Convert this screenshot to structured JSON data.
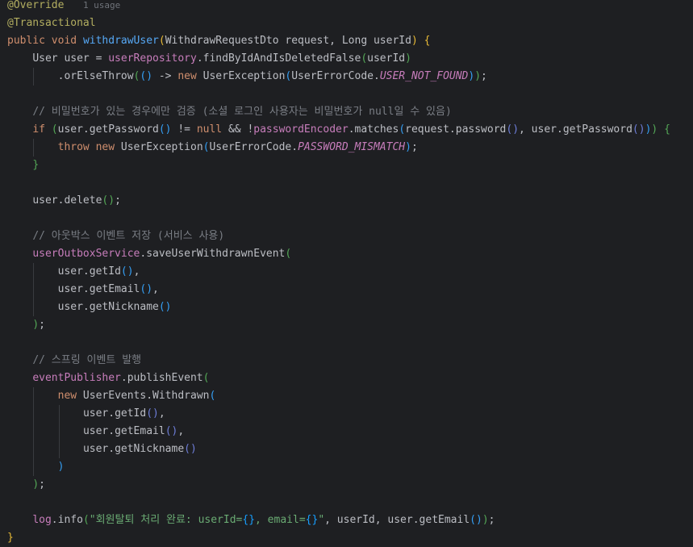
{
  "editor": {
    "language": "java",
    "theme": "dark",
    "colors": {
      "background": "#1e1f22",
      "default": "#bcbec4",
      "keyword": "#cf8e6d",
      "annotation": "#b3ae60",
      "method_declaration": "#56a8f5",
      "field": "#c77dbb",
      "comment": "#7a7e85",
      "string": "#6aab73",
      "inlay_hint": "#6f737a"
    },
    "lines": [
      {
        "indent": 0,
        "tokens": [
          {
            "t": "@Override",
            "c": "ann"
          },
          {
            "t": "   "
          },
          {
            "t": "1 usage",
            "c": "hint"
          }
        ]
      },
      {
        "indent": 0,
        "tokens": [
          {
            "t": "@Transactional",
            "c": "ann"
          }
        ]
      },
      {
        "indent": 0,
        "tokens": [
          {
            "t": "public",
            "c": "kw"
          },
          {
            "t": " "
          },
          {
            "t": "void",
            "c": "kw"
          },
          {
            "t": " "
          },
          {
            "t": "withdrawUser",
            "c": "fn"
          },
          {
            "t": "(",
            "c": "p1"
          },
          {
            "t": "WithdrawRequestDto request, Long userId"
          },
          {
            "t": ")",
            "c": "p1"
          },
          {
            "t": " "
          },
          {
            "t": "{",
            "c": "p1"
          }
        ]
      },
      {
        "indent": 1,
        "tokens": [
          {
            "t": "User user = "
          },
          {
            "t": "userRepository",
            "c": "field"
          },
          {
            "t": ".findByIdAndIsDeletedFalse"
          },
          {
            "t": "(",
            "c": "p2"
          },
          {
            "t": "userId"
          },
          {
            "t": ")",
            "c": "p2"
          }
        ]
      },
      {
        "indent": 2,
        "tokens": [
          {
            "t": ".orElseThrow"
          },
          {
            "t": "(",
            "c": "p2"
          },
          {
            "t": "()",
            "c": "p3"
          },
          {
            "t": " -> "
          },
          {
            "t": "new",
            "c": "kw"
          },
          {
            "t": " UserException"
          },
          {
            "t": "(",
            "c": "p3"
          },
          {
            "t": "UserErrorCode."
          },
          {
            "t": "USER_NOT_FOUND",
            "c": "static"
          },
          {
            "t": ")",
            "c": "p3"
          },
          {
            "t": ")",
            "c": "p2"
          },
          {
            "t": ";"
          }
        ]
      },
      {
        "indent": 0,
        "tokens": []
      },
      {
        "indent": 1,
        "tokens": [
          {
            "t": "// 비밀번호가 있는 경우에만 검증 (소셜 로그인 사용자는 비밀번호가 null일 수 있음)",
            "c": "cm"
          }
        ]
      },
      {
        "indent": 1,
        "tokens": [
          {
            "t": "if",
            "c": "kw"
          },
          {
            "t": " "
          },
          {
            "t": "(",
            "c": "p2"
          },
          {
            "t": "user.getPassword"
          },
          {
            "t": "()",
            "c": "p3"
          },
          {
            "t": " != "
          },
          {
            "t": "null",
            "c": "kw"
          },
          {
            "t": " && !"
          },
          {
            "t": "passwordEncoder",
            "c": "field"
          },
          {
            "t": ".matches"
          },
          {
            "t": "(",
            "c": "p3"
          },
          {
            "t": "request.password"
          },
          {
            "t": "()",
            "c": "p4"
          },
          {
            "t": ", user.getPassword"
          },
          {
            "t": "()",
            "c": "p4"
          },
          {
            "t": ")",
            "c": "p3"
          },
          {
            "t": ")",
            "c": "p2"
          },
          {
            "t": " "
          },
          {
            "t": "{",
            "c": "p2"
          }
        ]
      },
      {
        "indent": 2,
        "tokens": [
          {
            "t": "throw",
            "c": "kw"
          },
          {
            "t": " "
          },
          {
            "t": "new",
            "c": "kw"
          },
          {
            "t": " UserException"
          },
          {
            "t": "(",
            "c": "p3"
          },
          {
            "t": "UserErrorCode."
          },
          {
            "t": "PASSWORD_MISMATCH",
            "c": "static"
          },
          {
            "t": ")",
            "c": "p3"
          },
          {
            "t": ";"
          }
        ]
      },
      {
        "indent": 1,
        "tokens": [
          {
            "t": "}",
            "c": "p2"
          }
        ]
      },
      {
        "indent": 0,
        "tokens": []
      },
      {
        "indent": 1,
        "tokens": [
          {
            "t": "user.delete"
          },
          {
            "t": "()",
            "c": "p2"
          },
          {
            "t": ";"
          }
        ]
      },
      {
        "indent": 0,
        "tokens": []
      },
      {
        "indent": 1,
        "tokens": [
          {
            "t": "// 아웃박스 이벤트 저장 (서비스 사용)",
            "c": "cm"
          }
        ]
      },
      {
        "indent": 1,
        "tokens": [
          {
            "t": "userOutboxService",
            "c": "field"
          },
          {
            "t": ".saveUserWithdrawnEvent"
          },
          {
            "t": "(",
            "c": "p2"
          }
        ]
      },
      {
        "indent": 2,
        "tokens": [
          {
            "t": "user.getId"
          },
          {
            "t": "()",
            "c": "p3"
          },
          {
            "t": ","
          }
        ]
      },
      {
        "indent": 2,
        "tokens": [
          {
            "t": "user.getEmail"
          },
          {
            "t": "()",
            "c": "p3"
          },
          {
            "t": ","
          }
        ]
      },
      {
        "indent": 2,
        "tokens": [
          {
            "t": "user.getNickname"
          },
          {
            "t": "()",
            "c": "p3"
          }
        ]
      },
      {
        "indent": 1,
        "tokens": [
          {
            "t": ")",
            "c": "p2"
          },
          {
            "t": ";"
          }
        ]
      },
      {
        "indent": 0,
        "tokens": []
      },
      {
        "indent": 1,
        "tokens": [
          {
            "t": "// 스프링 이벤트 발행",
            "c": "cm"
          }
        ]
      },
      {
        "indent": 1,
        "tokens": [
          {
            "t": "eventPublisher",
            "c": "field"
          },
          {
            "t": ".publishEvent"
          },
          {
            "t": "(",
            "c": "p2"
          }
        ]
      },
      {
        "indent": 2,
        "tokens": [
          {
            "t": "new",
            "c": "kw"
          },
          {
            "t": " UserEvents.Withdrawn"
          },
          {
            "t": "(",
            "c": "p3"
          }
        ]
      },
      {
        "indent": 3,
        "tokens": [
          {
            "t": "user.getId"
          },
          {
            "t": "()",
            "c": "p4"
          },
          {
            "t": ","
          }
        ]
      },
      {
        "indent": 3,
        "tokens": [
          {
            "t": "user.getEmail"
          },
          {
            "t": "()",
            "c": "p4"
          },
          {
            "t": ","
          }
        ]
      },
      {
        "indent": 3,
        "tokens": [
          {
            "t": "user.getNickname"
          },
          {
            "t": "()",
            "c": "p4"
          }
        ]
      },
      {
        "indent": 2,
        "tokens": [
          {
            "t": ")",
            "c": "p3"
          }
        ]
      },
      {
        "indent": 1,
        "tokens": [
          {
            "t": ")",
            "c": "p2"
          },
          {
            "t": ";"
          }
        ]
      },
      {
        "indent": 0,
        "tokens": []
      },
      {
        "indent": 1,
        "tokens": [
          {
            "t": "log",
            "c": "field"
          },
          {
            "t": ".info"
          },
          {
            "t": "(",
            "c": "p2"
          },
          {
            "t": "\"회원탈퇴 처리 완료: userId=",
            "c": "str"
          },
          {
            "t": "{}",
            "c": "p5"
          },
          {
            "t": ", email=",
            "c": "str"
          },
          {
            "t": "{}",
            "c": "p5"
          },
          {
            "t": "\"",
            "c": "str"
          },
          {
            "t": ", userId, user.getEmail"
          },
          {
            "t": "()",
            "c": "p3"
          },
          {
            "t": ")",
            "c": "p2"
          },
          {
            "t": ";"
          }
        ]
      },
      {
        "indent": 0,
        "tokens": [
          {
            "t": "}",
            "c": "p1"
          }
        ]
      }
    ]
  }
}
